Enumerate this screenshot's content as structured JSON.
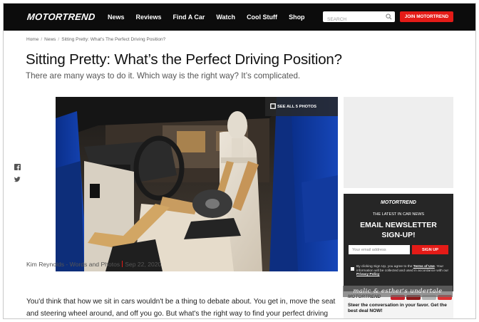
{
  "header": {
    "logo": "MOTORTREND",
    "nav": [
      "News",
      "Reviews",
      "Find A Car",
      "Watch",
      "Cool Stuff",
      "Shop"
    ],
    "search_placeholder": "SEARCH",
    "join_label": "JOIN MOTORTREND"
  },
  "breadcrumb": {
    "items": [
      "Home",
      "News",
      "Sitting Pretty: What's The Perfect Driving Position?"
    ]
  },
  "article": {
    "title": "Sitting Pretty: What’s the Perfect Driving Position?",
    "subtitle": "There are many ways to do it. Which way is the right way? It’s complicated.",
    "see_all_photos": "SEE ALL 5 PHOTOS",
    "author": "Kim Reynolds - Words and Photos",
    "date": "Sep 22, 2020",
    "body_line_1": "You'd think that how we sit in cars wouldn't be a thing to debate about. You get in, move the seat",
    "body_line_2": "and steering wheel around, and off you go. But what's the right way to find your perfect driving"
  },
  "social": {
    "icons": [
      "facebook-icon",
      "twitter-icon"
    ]
  },
  "newsletter": {
    "logo": "MOTORTREND",
    "kicker": "THE LATEST IN CAR NEWS",
    "title_line_1": "EMAIL NEWSLETTER",
    "title_line_2": "SIGN-UP!",
    "email_placeholder": "Your email address",
    "signup_label": "SIGN UP",
    "terms_prefix": "By clicking Sign Up, you agree to the",
    "terms_link": "Terms of Use",
    "terms_mid": ". Your information will be collected and used in accordance with our",
    "privacy_link": "Privacy Policy",
    "promo_logo": "MOTORTREND",
    "promo_text": "Steer the conversation in your favor. Get the best deal NOW!"
  },
  "watermark": "malic & esther's undertale",
  "colors": {
    "brand_red": "#e41b17",
    "header_black": "#0c0c0c",
    "rail_dark": "#262626"
  }
}
